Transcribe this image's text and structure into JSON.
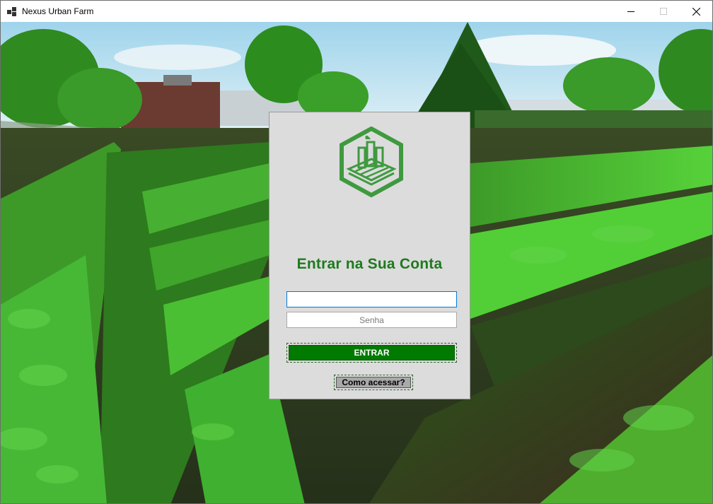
{
  "window": {
    "title": "Nexus Urban Farm",
    "minimize_icon": "minimize-icon",
    "maximize_icon": "maximize-icon",
    "close_icon": "close-icon"
  },
  "background": {
    "description_icon": "urban-farm-photo",
    "colors": {
      "sky": "#bfe3f2",
      "soil": "#2a3a1a",
      "crops_bright": "#3fbf2f",
      "crops_dark": "#1f5a12"
    }
  },
  "login": {
    "logo_icon": "urban-farm-logo-icon",
    "heading": "Entrar na Sua Conta",
    "username": {
      "value": "",
      "placeholder": ""
    },
    "password": {
      "value": "",
      "placeholder": "Senha"
    },
    "submit_label": "ENTRAR",
    "help_label": "Como acessar?"
  },
  "colors": {
    "accent": "#007a00",
    "heading": "#1f7a1f",
    "panel": "#dcdcdc",
    "focus": "#0078d7"
  }
}
